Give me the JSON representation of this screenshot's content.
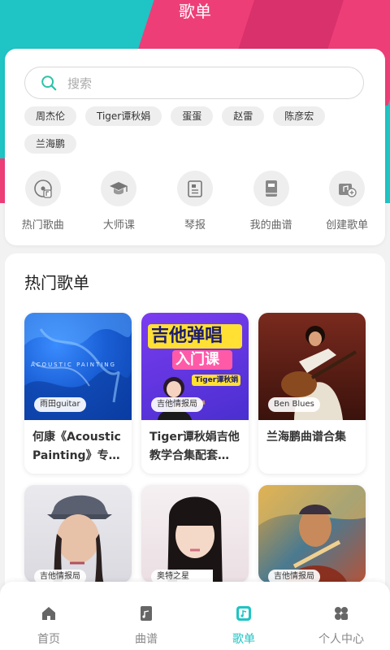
{
  "header": {
    "title": "歌单"
  },
  "search": {
    "placeholder": "搜索"
  },
  "tags": [
    "周杰伦",
    "Tiger谭秋娟",
    "蛋蛋",
    "赵雷",
    "陈彦宏",
    "兰海鹏"
  ],
  "quick": [
    {
      "label": "热门歌曲",
      "icon": "music-disc-icon"
    },
    {
      "label": "大师课",
      "icon": "graduation-cap-icon"
    },
    {
      "label": "琴报",
      "icon": "newspaper-icon"
    },
    {
      "label": "我的曲谱",
      "icon": "book-icon"
    },
    {
      "label": "创建歌单",
      "icon": "add-playlist-icon"
    }
  ],
  "section": {
    "title": "热门歌单"
  },
  "playlists": [
    {
      "badge": "雨田guitar",
      "name": "何康《Acoustic Painting》专…",
      "cover_text": "ACOUSTIC PAINTING"
    },
    {
      "badge": "吉他情报局",
      "name": "Tiger谭秋娟吉他教学合集配套…",
      "cover_title1": "吉他弹唱",
      "cover_title2": "入门课",
      "cover_sub": "Tiger谭秋娟"
    },
    {
      "badge": "Ben Blues",
      "name": "兰海鹏曲谱合集"
    },
    {
      "badge": "吉他情报局",
      "name": ""
    },
    {
      "badge": "奥特之星",
      "name": ""
    },
    {
      "badge": "吉他情报局",
      "name": ""
    }
  ],
  "tabs": [
    {
      "label": "首页",
      "icon": "home-icon"
    },
    {
      "label": "曲谱",
      "icon": "score-icon"
    },
    {
      "label": "歌单",
      "icon": "playlist-icon",
      "active": true
    },
    {
      "label": "个人中心",
      "icon": "profile-icon"
    }
  ],
  "colors": {
    "accent": "#1fc4c4",
    "pink": "#ee3e78"
  }
}
